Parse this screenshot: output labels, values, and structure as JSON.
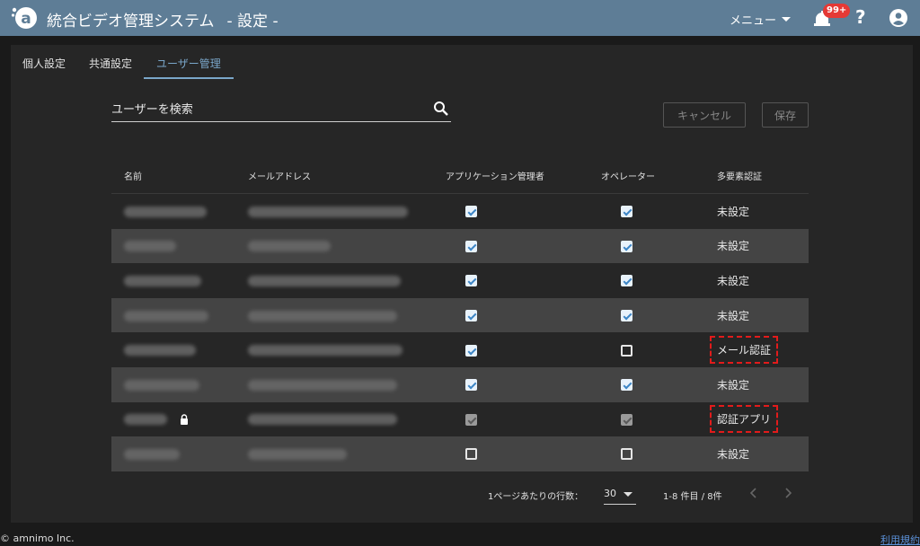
{
  "header": {
    "title": "統合ビデオ管理システム",
    "subtitle": "- 設定 -",
    "menu_label": "メニュー",
    "notification_count": "99+",
    "help_label": "?"
  },
  "tabs": [
    {
      "label": "個人設定"
    },
    {
      "label": "共通設定"
    },
    {
      "label": "ユーザー管理"
    }
  ],
  "search": {
    "placeholder": "ユーザーを検索"
  },
  "buttons": {
    "cancel": "キャンセル",
    "save": "保存"
  },
  "table": {
    "headers": {
      "name": "名前",
      "email": "メールアドレス",
      "app_admin": "アプリケーション管理者",
      "operator": "オペレーター",
      "mfa": "多要素認証"
    },
    "rows": [
      {
        "app_admin": "checked",
        "operator": "checked",
        "mfa": "未設定",
        "locked": false,
        "mfa_highlight": false
      },
      {
        "app_admin": "checked",
        "operator": "checked",
        "mfa": "未設定",
        "locked": false,
        "mfa_highlight": false
      },
      {
        "app_admin": "checked",
        "operator": "checked",
        "mfa": "未設定",
        "locked": false,
        "mfa_highlight": false
      },
      {
        "app_admin": "checked",
        "operator": "checked",
        "mfa": "未設定",
        "locked": false,
        "mfa_highlight": false
      },
      {
        "app_admin": "checked",
        "operator": "empty",
        "mfa": "メール認証",
        "locked": false,
        "mfa_highlight": true
      },
      {
        "app_admin": "checked",
        "operator": "checked",
        "mfa": "未設定",
        "locked": false,
        "mfa_highlight": false
      },
      {
        "app_admin": "disabled",
        "operator": "disabled",
        "mfa": "認証アプリ",
        "locked": true,
        "mfa_highlight": true
      },
      {
        "app_admin": "empty",
        "operator": "empty",
        "mfa": "未設定",
        "locked": false,
        "mfa_highlight": false
      }
    ]
  },
  "pagination": {
    "rows_per_page_label": "1ページあたりの行数：",
    "rows_per_page": "30",
    "range": "1-8 件目 / 8件"
  },
  "footer": {
    "copyright": "© amnimo Inc.",
    "terms": "利用規約"
  },
  "colors": {
    "header_bg": "#5e7d96",
    "active_tab": "#7aa6c9",
    "badge": "#e53935",
    "highlight": "#e21b1b"
  }
}
